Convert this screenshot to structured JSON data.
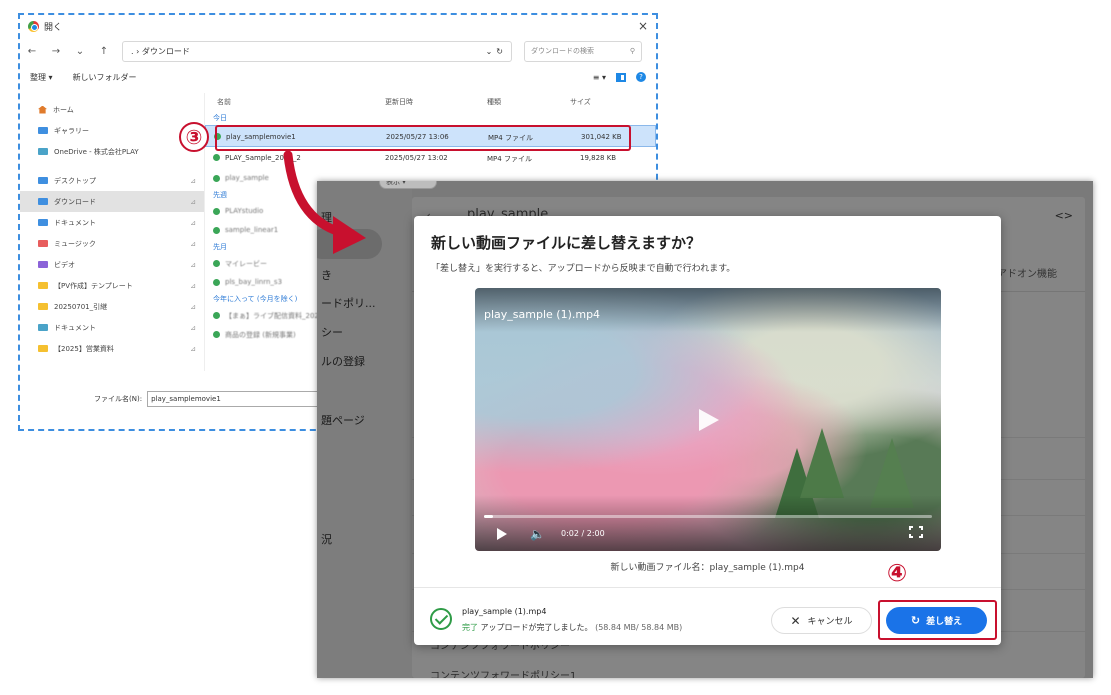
{
  "file_dialog": {
    "title": "開く",
    "close": "×",
    "path": ". › ダウンロード",
    "search_placeholder": "ダウンロードの検索",
    "organize": "整理 ▾",
    "new_folder": "新しいフォルダー",
    "view_menu": "≡ ▾",
    "help": "?",
    "sidebar": [
      {
        "label": "ホーム",
        "icon": "home",
        "section": 1
      },
      {
        "label": "ギャラリー",
        "icon": "blue",
        "section": 1
      },
      {
        "label": "OneDrive - 株式会社PLAY",
        "icon": "teal",
        "section": 1
      },
      {
        "label": "デスクトップ",
        "icon": "blue",
        "section": 2
      },
      {
        "label": "ダウンロード",
        "icon": "blue",
        "section": 2,
        "selected": true
      },
      {
        "label": "ドキュメント",
        "icon": "blue",
        "section": 2
      },
      {
        "label": "ミュージック",
        "icon": "red",
        "section": 2
      },
      {
        "label": "ビデオ",
        "icon": "purple",
        "section": 2
      },
      {
        "label": "【PV作成】テンプレート",
        "icon": "yellow",
        "section": 2
      },
      {
        "label": "20250701_引継",
        "icon": "yellow",
        "section": 2
      },
      {
        "label": "ドキュメント",
        "icon": "teal",
        "section": 2
      },
      {
        "label": "【2025】営業資料",
        "icon": "yellow",
        "section": 2
      }
    ],
    "columns": {
      "name": "名前",
      "date": "更新日時",
      "type": "種類",
      "size": "サイズ"
    },
    "group_today": "今日",
    "files": [
      {
        "name": "play_samplemovie1",
        "date": "2025/05/27 13:06",
        "type": "MP4 ファイル",
        "size": "301,042 KB",
        "selected": true
      },
      {
        "name": "PLAY_Sample_2023_2",
        "date": "2025/05/27 13:02",
        "type": "MP4 ファイル",
        "size": "19,828 KB"
      }
    ],
    "other_files": [
      {
        "name": "play_sample",
        "kind": "file"
      },
      {
        "name": "先週",
        "kind": "group"
      },
      {
        "name": "PLAYstudio",
        "kind": "file"
      },
      {
        "name": "sample_linear1",
        "kind": "file"
      },
      {
        "name": "先月",
        "kind": "group"
      },
      {
        "name": "マイレービー",
        "kind": "file"
      },
      {
        "name": "pls_bay_linrn_s3",
        "kind": "file"
      },
      {
        "name": "今年に入って (今月を除く)",
        "kind": "group"
      },
      {
        "name": "【まぁ】ライブ配信資料_20250123",
        "kind": "file"
      },
      {
        "name": "商品の登録 (新規事業)",
        "kind": "file"
      }
    ],
    "filename_label": "ファイル名(N):",
    "filename_value": "play_samplemovie1"
  },
  "background_app": {
    "header_title": "play_sample",
    "code_icon": "<>",
    "tab_addon": "アドオン機能",
    "sidebar_items": [
      "理",
      "き",
      "ードポリ...",
      "シー",
      "ルの登録",
      "題ページ",
      "況"
    ],
    "footer_lines": [
      "コンテンツフォワードポリシー",
      "コンテンツフォワードポリシー1"
    ],
    "peek_label": "表示 ▾"
  },
  "modal": {
    "title": "新しい動画ファイルに差し替えますか？",
    "subtitle": "「差し替え」を実行すると、アップロードから反映まで自動で行われます。",
    "video": {
      "filename": "play_sample (1).mp4",
      "time": "0:02 / 2:00",
      "progress": 0.02
    },
    "caption": "新しい動画ファイル名：play_sample (1).mp4",
    "upload": {
      "filename": "play_sample (1).mp4",
      "status_ok": "完了",
      "status_text": " アップロードが完了しました。",
      "size": " (58.84 MB/ 58.84 MB)"
    },
    "cancel_label": "キャンセル",
    "replace_label": "差し替え"
  },
  "annotations": {
    "step3": "③",
    "step4": "④",
    "colors": {
      "highlight": "#c8102e",
      "primary": "#1a73e8",
      "success": "#2e9b46",
      "dialog_border": "#3d8ee0"
    }
  }
}
